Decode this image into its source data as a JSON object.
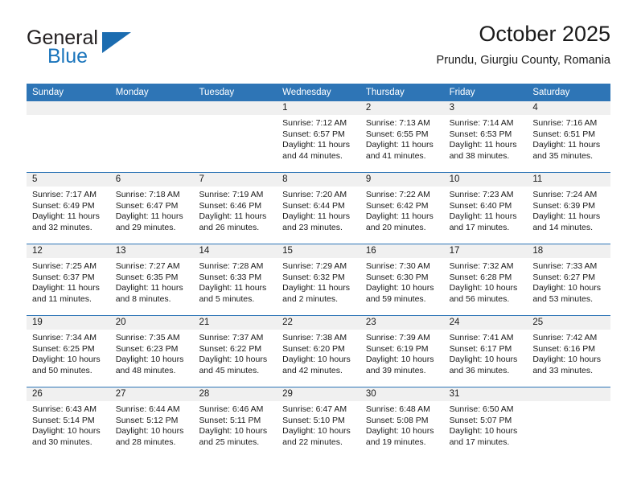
{
  "brand": {
    "name_part1": "General",
    "name_part2": "Blue",
    "logo_icon": "blue-triangle-icon"
  },
  "header": {
    "title": "October 2025",
    "subtitle": "Prundu, Giurgiu County, Romania"
  },
  "theme": {
    "header_blue": "#2e75b6",
    "daynum_band": "#f0f0f0",
    "brand_blue": "#1b75bc",
    "text": "#1a1a1a"
  },
  "calendar": {
    "weekday_headers": [
      "Sunday",
      "Monday",
      "Tuesday",
      "Wednesday",
      "Thursday",
      "Friday",
      "Saturday"
    ],
    "weeks": [
      [
        {
          "day": "",
          "empty": true,
          "sunrise": "",
          "sunset": "",
          "daylight_line1": "",
          "daylight_line2": ""
        },
        {
          "day": "",
          "empty": true,
          "sunrise": "",
          "sunset": "",
          "daylight_line1": "",
          "daylight_line2": ""
        },
        {
          "day": "",
          "empty": true,
          "sunrise": "",
          "sunset": "",
          "daylight_line1": "",
          "daylight_line2": ""
        },
        {
          "day": "1",
          "empty": false,
          "sunrise": "Sunrise: 7:12 AM",
          "sunset": "Sunset: 6:57 PM",
          "daylight_line1": "Daylight: 11 hours",
          "daylight_line2": "and 44 minutes."
        },
        {
          "day": "2",
          "empty": false,
          "sunrise": "Sunrise: 7:13 AM",
          "sunset": "Sunset: 6:55 PM",
          "daylight_line1": "Daylight: 11 hours",
          "daylight_line2": "and 41 minutes."
        },
        {
          "day": "3",
          "empty": false,
          "sunrise": "Sunrise: 7:14 AM",
          "sunset": "Sunset: 6:53 PM",
          "daylight_line1": "Daylight: 11 hours",
          "daylight_line2": "and 38 minutes."
        },
        {
          "day": "4",
          "empty": false,
          "sunrise": "Sunrise: 7:16 AM",
          "sunset": "Sunset: 6:51 PM",
          "daylight_line1": "Daylight: 11 hours",
          "daylight_line2": "and 35 minutes."
        }
      ],
      [
        {
          "day": "5",
          "empty": false,
          "sunrise": "Sunrise: 7:17 AM",
          "sunset": "Sunset: 6:49 PM",
          "daylight_line1": "Daylight: 11 hours",
          "daylight_line2": "and 32 minutes."
        },
        {
          "day": "6",
          "empty": false,
          "sunrise": "Sunrise: 7:18 AM",
          "sunset": "Sunset: 6:47 PM",
          "daylight_line1": "Daylight: 11 hours",
          "daylight_line2": "and 29 minutes."
        },
        {
          "day": "7",
          "empty": false,
          "sunrise": "Sunrise: 7:19 AM",
          "sunset": "Sunset: 6:46 PM",
          "daylight_line1": "Daylight: 11 hours",
          "daylight_line2": "and 26 minutes."
        },
        {
          "day": "8",
          "empty": false,
          "sunrise": "Sunrise: 7:20 AM",
          "sunset": "Sunset: 6:44 PM",
          "daylight_line1": "Daylight: 11 hours",
          "daylight_line2": "and 23 minutes."
        },
        {
          "day": "9",
          "empty": false,
          "sunrise": "Sunrise: 7:22 AM",
          "sunset": "Sunset: 6:42 PM",
          "daylight_line1": "Daylight: 11 hours",
          "daylight_line2": "and 20 minutes."
        },
        {
          "day": "10",
          "empty": false,
          "sunrise": "Sunrise: 7:23 AM",
          "sunset": "Sunset: 6:40 PM",
          "daylight_line1": "Daylight: 11 hours",
          "daylight_line2": "and 17 minutes."
        },
        {
          "day": "11",
          "empty": false,
          "sunrise": "Sunrise: 7:24 AM",
          "sunset": "Sunset: 6:39 PM",
          "daylight_line1": "Daylight: 11 hours",
          "daylight_line2": "and 14 minutes."
        }
      ],
      [
        {
          "day": "12",
          "empty": false,
          "sunrise": "Sunrise: 7:25 AM",
          "sunset": "Sunset: 6:37 PM",
          "daylight_line1": "Daylight: 11 hours",
          "daylight_line2": "and 11 minutes."
        },
        {
          "day": "13",
          "empty": false,
          "sunrise": "Sunrise: 7:27 AM",
          "sunset": "Sunset: 6:35 PM",
          "daylight_line1": "Daylight: 11 hours",
          "daylight_line2": "and 8 minutes."
        },
        {
          "day": "14",
          "empty": false,
          "sunrise": "Sunrise: 7:28 AM",
          "sunset": "Sunset: 6:33 PM",
          "daylight_line1": "Daylight: 11 hours",
          "daylight_line2": "and 5 minutes."
        },
        {
          "day": "15",
          "empty": false,
          "sunrise": "Sunrise: 7:29 AM",
          "sunset": "Sunset: 6:32 PM",
          "daylight_line1": "Daylight: 11 hours",
          "daylight_line2": "and 2 minutes."
        },
        {
          "day": "16",
          "empty": false,
          "sunrise": "Sunrise: 7:30 AM",
          "sunset": "Sunset: 6:30 PM",
          "daylight_line1": "Daylight: 10 hours",
          "daylight_line2": "and 59 minutes."
        },
        {
          "day": "17",
          "empty": false,
          "sunrise": "Sunrise: 7:32 AM",
          "sunset": "Sunset: 6:28 PM",
          "daylight_line1": "Daylight: 10 hours",
          "daylight_line2": "and 56 minutes."
        },
        {
          "day": "18",
          "empty": false,
          "sunrise": "Sunrise: 7:33 AM",
          "sunset": "Sunset: 6:27 PM",
          "daylight_line1": "Daylight: 10 hours",
          "daylight_line2": "and 53 minutes."
        }
      ],
      [
        {
          "day": "19",
          "empty": false,
          "sunrise": "Sunrise: 7:34 AM",
          "sunset": "Sunset: 6:25 PM",
          "daylight_line1": "Daylight: 10 hours",
          "daylight_line2": "and 50 minutes."
        },
        {
          "day": "20",
          "empty": false,
          "sunrise": "Sunrise: 7:35 AM",
          "sunset": "Sunset: 6:23 PM",
          "daylight_line1": "Daylight: 10 hours",
          "daylight_line2": "and 48 minutes."
        },
        {
          "day": "21",
          "empty": false,
          "sunrise": "Sunrise: 7:37 AM",
          "sunset": "Sunset: 6:22 PM",
          "daylight_line1": "Daylight: 10 hours",
          "daylight_line2": "and 45 minutes."
        },
        {
          "day": "22",
          "empty": false,
          "sunrise": "Sunrise: 7:38 AM",
          "sunset": "Sunset: 6:20 PM",
          "daylight_line1": "Daylight: 10 hours",
          "daylight_line2": "and 42 minutes."
        },
        {
          "day": "23",
          "empty": false,
          "sunrise": "Sunrise: 7:39 AM",
          "sunset": "Sunset: 6:19 PM",
          "daylight_line1": "Daylight: 10 hours",
          "daylight_line2": "and 39 minutes."
        },
        {
          "day": "24",
          "empty": false,
          "sunrise": "Sunrise: 7:41 AM",
          "sunset": "Sunset: 6:17 PM",
          "daylight_line1": "Daylight: 10 hours",
          "daylight_line2": "and 36 minutes."
        },
        {
          "day": "25",
          "empty": false,
          "sunrise": "Sunrise: 7:42 AM",
          "sunset": "Sunset: 6:16 PM",
          "daylight_line1": "Daylight: 10 hours",
          "daylight_line2": "and 33 minutes."
        }
      ],
      [
        {
          "day": "26",
          "empty": false,
          "sunrise": "Sunrise: 6:43 AM",
          "sunset": "Sunset: 5:14 PM",
          "daylight_line1": "Daylight: 10 hours",
          "daylight_line2": "and 30 minutes."
        },
        {
          "day": "27",
          "empty": false,
          "sunrise": "Sunrise: 6:44 AM",
          "sunset": "Sunset: 5:12 PM",
          "daylight_line1": "Daylight: 10 hours",
          "daylight_line2": "and 28 minutes."
        },
        {
          "day": "28",
          "empty": false,
          "sunrise": "Sunrise: 6:46 AM",
          "sunset": "Sunset: 5:11 PM",
          "daylight_line1": "Daylight: 10 hours",
          "daylight_line2": "and 25 minutes."
        },
        {
          "day": "29",
          "empty": false,
          "sunrise": "Sunrise: 6:47 AM",
          "sunset": "Sunset: 5:10 PM",
          "daylight_line1": "Daylight: 10 hours",
          "daylight_line2": "and 22 minutes."
        },
        {
          "day": "30",
          "empty": false,
          "sunrise": "Sunrise: 6:48 AM",
          "sunset": "Sunset: 5:08 PM",
          "daylight_line1": "Daylight: 10 hours",
          "daylight_line2": "and 19 minutes."
        },
        {
          "day": "31",
          "empty": false,
          "sunrise": "Sunrise: 6:50 AM",
          "sunset": "Sunset: 5:07 PM",
          "daylight_line1": "Daylight: 10 hours",
          "daylight_line2": "and 17 minutes."
        },
        {
          "day": "",
          "empty": true,
          "sunrise": "",
          "sunset": "",
          "daylight_line1": "",
          "daylight_line2": ""
        }
      ]
    ]
  }
}
